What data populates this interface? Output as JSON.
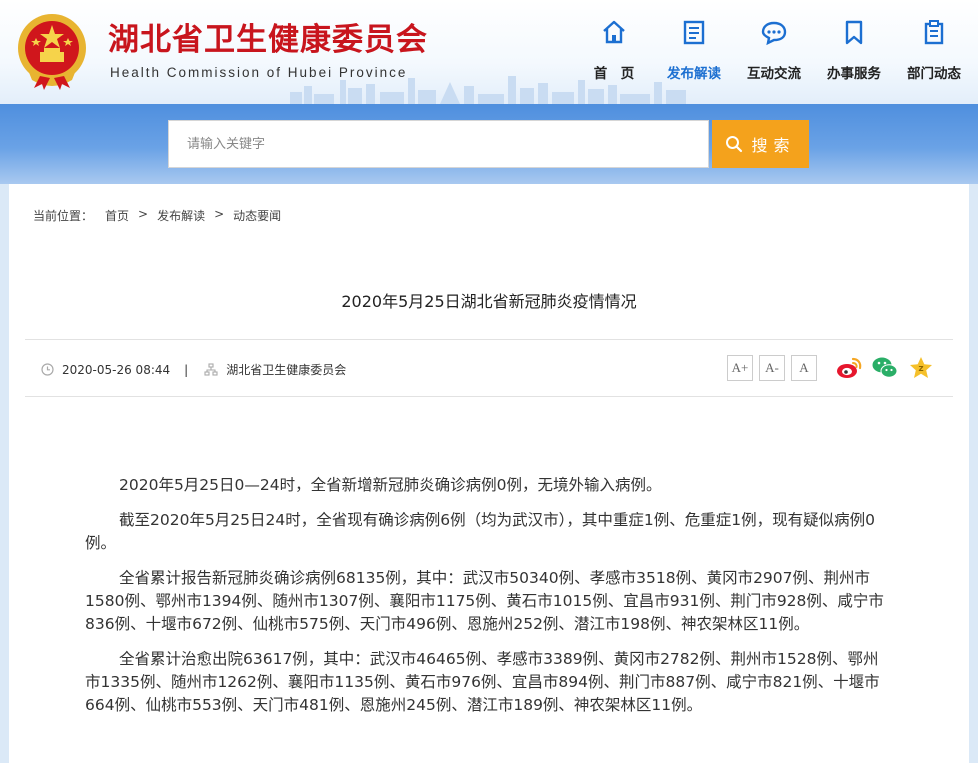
{
  "header": {
    "title": "湖北省卫生健康委员会",
    "subtitle": "Health Commission of Hubei Province",
    "nav": [
      {
        "label": "首　页",
        "icon": "home-icon",
        "active": false
      },
      {
        "label": "发布解读",
        "icon": "document-icon",
        "active": true
      },
      {
        "label": "互动交流",
        "icon": "chat-icon",
        "active": false
      },
      {
        "label": "办事服务",
        "icon": "bookmark-icon",
        "active": false
      },
      {
        "label": "部门动态",
        "icon": "clipboard-icon",
        "active": false
      }
    ]
  },
  "search": {
    "placeholder": "请输入关键字",
    "button_label": "搜索"
  },
  "breadcrumb": {
    "prefix": "当前位置：",
    "items": [
      "首页",
      "发布解读",
      "动态要闻"
    ],
    "separator": ">"
  },
  "article": {
    "title": "2020年5月25日湖北省新冠肺炎疫情情况",
    "date": "2020-05-26 08:44",
    "meta_separator": "|",
    "source": "湖北省卫生健康委员会",
    "font_buttons": [
      "A+",
      "A-",
      "A"
    ],
    "share_icons": [
      "weibo-icon",
      "wechat-icon",
      "star-icon"
    ],
    "paragraphs": [
      "2020年5月25日0—24时，全省新增新冠肺炎确诊病例0例，无境外输入病例。",
      "截至2020年5月25日24时，全省现有确诊病例6例（均为武汉市），其中重症1例、危重症1例，现有疑似病例0例。",
      "全省累计报告新冠肺炎确诊病例68135例，其中：武汉市50340例、孝感市3518例、黄冈市2907例、荆州市1580例、鄂州市1394例、随州市1307例、襄阳市1175例、黄石市1015例、宜昌市931例、荆门市928例、咸宁市836例、十堰市672例、仙桃市575例、天门市496例、恩施州252例、潜江市198例、神农架林区11例。",
      "全省累计治愈出院63617例，其中：武汉市46465例、孝感市3389例、黄冈市2782例、荆州市1528例、鄂州市1335例、随州市1262例、襄阳市1135例、黄石市976例、宜昌市894例、荆门市887例、咸宁市821例、十堰市664例、仙桃市553例、天门市481例、恩施州245例、潜江市189例、神农架林区11例。"
    ]
  },
  "colors": {
    "brand_red": "#c8151d",
    "accent_blue": "#1c6fd1",
    "search_button": "#f4a21c"
  }
}
